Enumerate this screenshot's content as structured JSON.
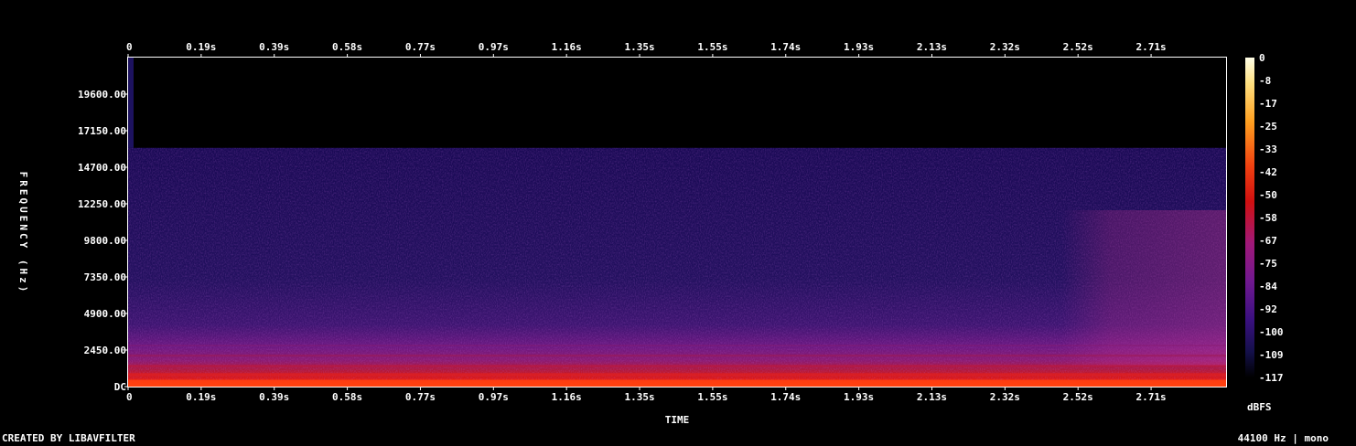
{
  "chart_data": {
    "type": "heatmap",
    "title": "",
    "xlabel": "TIME",
    "ylabel": "FREQUENCY (Hz)",
    "x_ticks": [
      "0",
      "0.19s",
      "0.39s",
      "0.58s",
      "0.77s",
      "0.97s",
      "1.16s",
      "1.35s",
      "1.55s",
      "1.74s",
      "1.93s",
      "2.13s",
      "2.32s",
      "2.52s",
      "2.71s"
    ],
    "x_tick_values": [
      0,
      0.193,
      0.386,
      0.579,
      0.772,
      0.965,
      1.158,
      1.351,
      1.544,
      1.737,
      1.93,
      2.123,
      2.316,
      2.509,
      2.702
    ],
    "xlim": [
      0,
      2.9
    ],
    "y_ticks": [
      "DC",
      "2450.00",
      "4900.00",
      "7350.00",
      "9800.00",
      "12250.00",
      "14700.00",
      "17150.00",
      "19600.00"
    ],
    "y_tick_values": [
      0,
      2450,
      4900,
      7350,
      9800,
      12250,
      14700,
      17150,
      19600
    ],
    "ylim": [
      0,
      22050
    ],
    "colorbar": {
      "label": "dBFS",
      "ticks": [
        "0",
        "-8",
        "-17",
        "-25",
        "-33",
        "-42",
        "-50",
        "-58",
        "-67",
        "-75",
        "-84",
        "-92",
        "-100",
        "-109",
        "-117"
      ],
      "range": [
        -117,
        0
      ]
    },
    "notes": {
      "content_cutoff_hz": 16000,
      "noise_floor_dbfs": -98,
      "low_band_dbfs": -50
    }
  },
  "footer": {
    "credits": "CREATED BY LIBAVFILTER",
    "audio_info": "44100 Hz | mono"
  },
  "colors": {
    "background": "#000000",
    "text": "#ffffff",
    "colormap": [
      "#000000",
      "#0b0b3d",
      "#2a1080",
      "#5a1a8a",
      "#8a1a8a",
      "#c01020",
      "#e83010",
      "#ff8000",
      "#ffd040",
      "#ffffe0"
    ]
  }
}
